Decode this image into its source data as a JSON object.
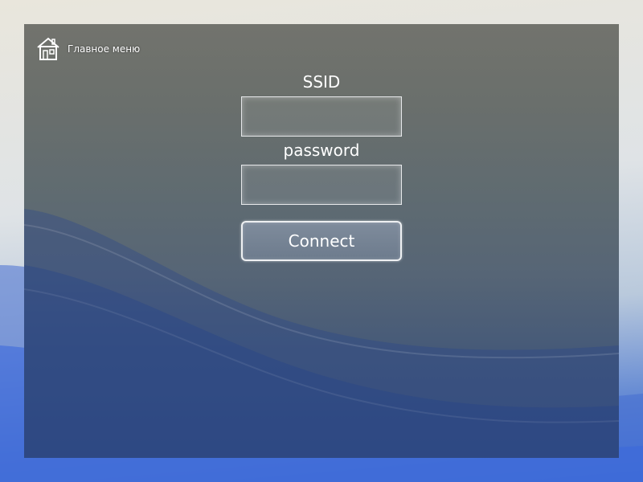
{
  "home": {
    "label": "Главное меню",
    "icon": "home-icon"
  },
  "form": {
    "ssid_label": "SSID",
    "ssid_value": "",
    "password_label": "password",
    "password_value": "",
    "connect_label": "Connect"
  },
  "colors": {
    "text": "#ffffff",
    "field_border": "#e6e8ea",
    "button_fill": "#75828f"
  }
}
